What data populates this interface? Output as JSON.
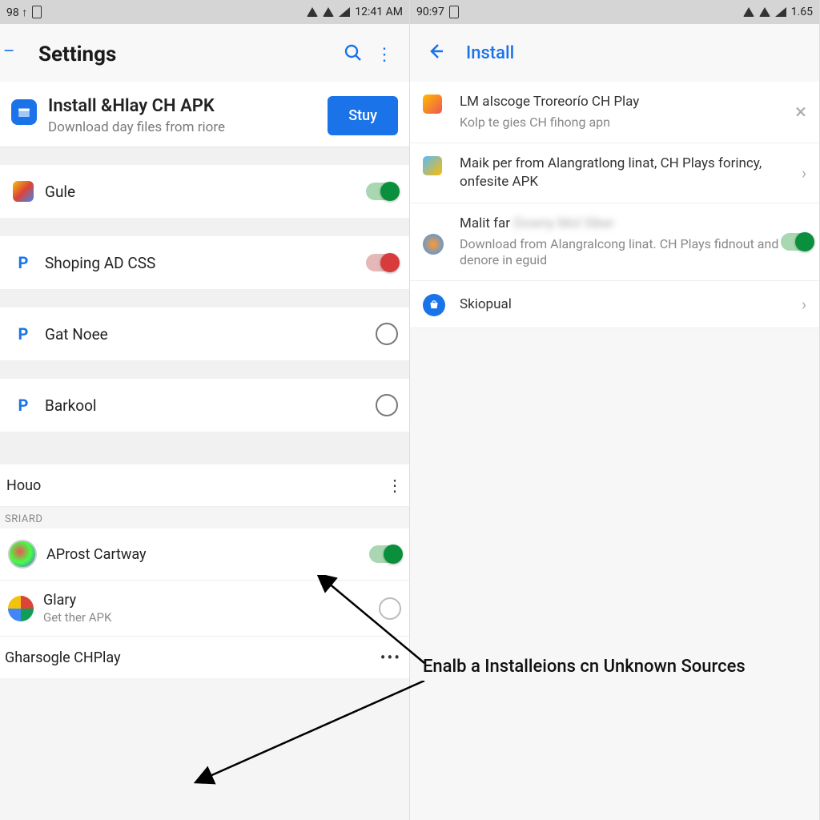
{
  "left": {
    "status": {
      "time": "12:41 AM",
      "left": "98 ↑"
    },
    "appbar": {
      "title": "Settings"
    },
    "promo": {
      "title": "Install  &Hlay CH APK",
      "sub": "Download day files from riore",
      "button": "Stuy"
    },
    "rows": [
      {
        "label": "Gule",
        "kind": "toggle-on"
      },
      {
        "label": "Shoping AD CSS",
        "kind": "toggle-off"
      },
      {
        "label": "Gat  Noee",
        "kind": "radio"
      },
      {
        "label": "Barkool",
        "kind": "radio"
      }
    ],
    "houo": "Houo",
    "category": "SRIARD",
    "apps": [
      {
        "name": "AProst Cartway",
        "kind": "toggle-on",
        "sub": ""
      },
      {
        "name": "Glary",
        "sub": "Get ther APK",
        "kind": "radio"
      },
      {
        "name": "Gharsogle CHPlay",
        "sub": "",
        "kind": "more"
      }
    ]
  },
  "right": {
    "status": {
      "time": "1.65",
      "left": "90:97"
    },
    "appbar": {
      "title": "Install"
    },
    "items": [
      {
        "title": "LM  aIscoge  Troreorío CH Play",
        "sub": "Kolp te gies CH fihong apn",
        "action": "chev"
      },
      {
        "title": "Maik per from Alangratlong linat, CH Plays forincy, onfesite APK",
        "sub": "",
        "action": "chev"
      },
      {
        "title": "Malit far",
        "sub": "Download from Alangralcong linat. CH Plays fidnout and denore in eguid",
        "action": "toggle-on",
        "blurred": true
      },
      {
        "title": "Skiopual",
        "sub": "",
        "action": "chev",
        "icon": "blue"
      }
    ]
  },
  "annotation": "Enalb a  Installeions  cn Unknown Sources"
}
